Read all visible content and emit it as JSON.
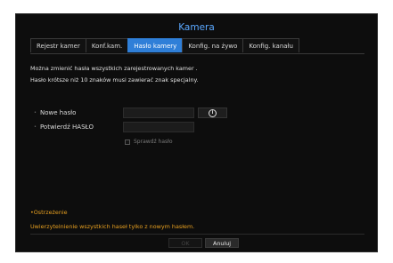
{
  "dialog": {
    "title": "Kamera"
  },
  "tabs": [
    {
      "label": "Rejestr kamer",
      "active": false
    },
    {
      "label": "Konf.kam.",
      "active": false
    },
    {
      "label": "Hasło kamery",
      "active": true
    },
    {
      "label": "Konfig. na żywo",
      "active": false
    },
    {
      "label": "Konfig. kanału",
      "active": false
    }
  ],
  "info": {
    "line1": "Można zmienić hasła wszystkich zarejestrowanych kamer .",
    "line2": "Hasło krótsze niż 10 znaków musi zawierać znak specjalny."
  },
  "form": {
    "new_password_label": "Nowe hasło",
    "new_password_value": "",
    "confirm_password_label": "Potwierdź HASŁO",
    "confirm_password_value": "",
    "info_button_icon": "info-icon",
    "show_password_label": "Sprawdź hasło",
    "show_password_checked": false
  },
  "warning": {
    "title": "•Ostrzeżenie",
    "text": "Uwierzytelnienie wszystkich haseł tylko z nowym hasłem."
  },
  "buttons": {
    "ok": "OK",
    "cancel": "Anuluj"
  },
  "colors": {
    "accent": "#2f7fd8",
    "title": "#5aa8ff",
    "warning": "#e8a020",
    "background": "#0d0d0d"
  }
}
